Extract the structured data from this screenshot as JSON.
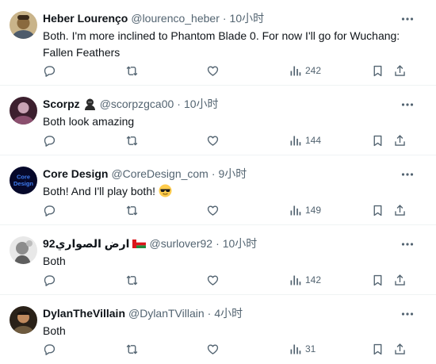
{
  "replies": [
    {
      "name": "Heber Lourenço",
      "handle": "@lourenco_heber",
      "dot": "·",
      "time": "10小时",
      "text": "Both. I'm more inclined to Phantom Blade 0. For now I'll go for Wuchang: Fallen Feathers",
      "views": "242",
      "avatar_color": "#b89a5e"
    },
    {
      "name": "Scorpz",
      "handle": "@scorpzgca00",
      "dot": "·",
      "time": "10小时",
      "text": "Both look amazing",
      "views": "144",
      "avatar_color": "#6a3b52"
    },
    {
      "name": "Core Design",
      "handle": "@CoreDesign_com",
      "dot": "·",
      "time": "9小时",
      "text": "Both! And I'll play both!",
      "views": "149",
      "avatar_color": "#0b0e3a",
      "avatar_text": "Core Design"
    },
    {
      "name": "ارض الصواري92",
      "handle": "@surlover92",
      "dot": "·",
      "time": "10小时",
      "text": "Both",
      "views": "142",
      "avatar_color": "#9a9a9a"
    },
    {
      "name": "DylanTheVillain",
      "handle": "@DylanTVillain",
      "dot": "·",
      "time": "4小时",
      "text": "Both",
      "views": "31",
      "avatar_color": "#4a3a2a"
    }
  ],
  "icons": {
    "reply": "reply-icon",
    "retweet": "retweet-icon",
    "like": "like-icon",
    "views": "views-icon",
    "bookmark": "bookmark-icon",
    "share": "share-icon",
    "more": "more-icon"
  },
  "colors": {
    "text": "#0f1419",
    "secondary": "#536471",
    "divider": "#eff3f4"
  }
}
